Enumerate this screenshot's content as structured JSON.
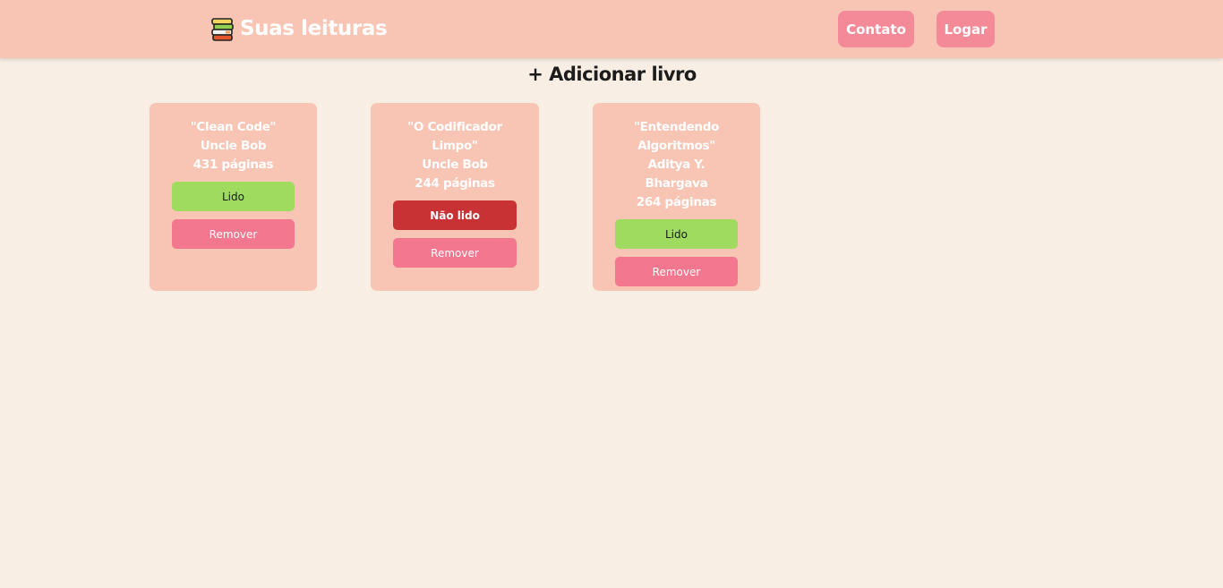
{
  "header": {
    "brand_title": "Suas leituras",
    "brand_icon": "books-stack-icon",
    "nav": {
      "contato_label": "Contato",
      "logar_label": "Logar"
    }
  },
  "main": {
    "add_book_label": "+ Adicionar livro",
    "books": [
      {
        "title": "\"Clean Code\"",
        "author": "Uncle Bob",
        "pages": "431 páginas",
        "status_label": "Lido",
        "remove_label": "Remover"
      },
      {
        "title_line1": "\"O Codificador",
        "title_line2": "Limpo\"",
        "author": "Uncle Bob",
        "pages": "244 páginas",
        "status_label": "Não lido",
        "remove_label": "Remover"
      },
      {
        "title_line1": "\"Entendendo",
        "title_line2": "Algoritmos\"",
        "author": "Aditya Y. Bhargava",
        "pages": "264 páginas",
        "status_label": "Lido",
        "remove_label": "Remover"
      }
    ]
  },
  "colors": {
    "background": "#f8eee3",
    "navbar": "#f8c4b4",
    "nav_button": "#f48a98",
    "card": "#f8c4b4",
    "lido": "#9edb5f",
    "nao_lido": "#c83234",
    "remover": "#f3778e"
  }
}
